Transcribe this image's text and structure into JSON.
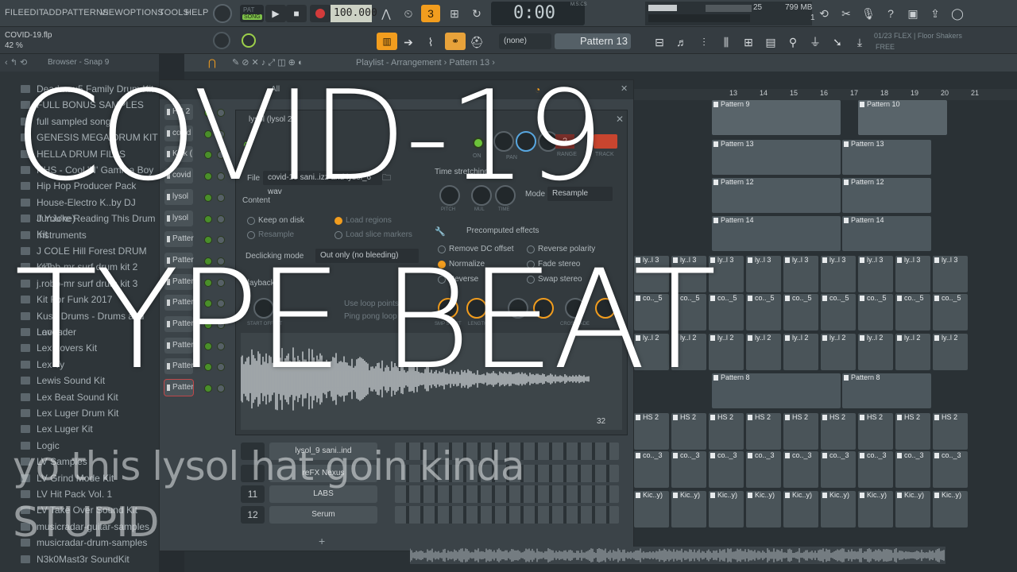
{
  "menu": [
    "FILE",
    "EDIT",
    "ADD",
    "PATTERNS",
    "VIEW",
    "OPTIONS",
    "TOOLS",
    "HELP"
  ],
  "transport": {
    "pat_label": "PAT",
    "song_label": "SONG",
    "tempo": "100.000",
    "time": "0:00",
    "time_sub": "00",
    "time_unit": "M:S:CS"
  },
  "system": {
    "cpu": "25",
    "memory": "799 MB",
    "polyphony": "1"
  },
  "project": {
    "name": "COVID-19.flp",
    "zoom": "42 %"
  },
  "pattern_bar": {
    "none_label": "(none)",
    "pattern_label": "Pattern 13"
  },
  "news": {
    "line1": "01/23  FLEX | Floor Shakers",
    "line2": "FREE"
  },
  "browser": {
    "title": "Browser - Snap 9",
    "items": [
      "Deadmau5 Family Drum Kit",
      "FULL BONUS SAMPLES",
      "full sampled songs",
      "GENESIS MEGA DRUM KIT",
      "HELLA DRUM FILLS",
      "HHS - Cool 'N' Gamma Boy",
      "Hip Hop Producer Pack",
      "House-Electro K..by DJ JunJoke)",
      "If You're Reading This Drum Kit",
      "Instruments",
      "J COLE Hill Forest DRUM KIT",
      "j.robb-mr surf drum kit 2",
      "j.robb-mr surf drum kit 3",
      "Kit For Funk 2017",
      "Kush Drums - Drums and Loops",
      "Lavender",
      "Lex Lovers Kit",
      "Lex Ty",
      "Lewis Sound Kit",
      "Lex Beat Sound Kit",
      "Lex Luger Drum Kit",
      "Lex Luger Kit",
      "Logic",
      "LV Samples",
      "LV Grind Mode Kit",
      "LV Hit Pack Vol. 1",
      "LV Take Over Sound Kit",
      "musicradar-guitar-samples",
      "musicradar-drum-samples",
      "N3k0Mast3r SoundKit"
    ]
  },
  "playlist": {
    "title": "Playlist - Arrangement › Pattern 13 ›",
    "ruler": [
      "13",
      "14",
      "15",
      "16",
      "17",
      "18",
      "19",
      "20",
      "21"
    ],
    "clips": [
      {
        "label": "Pattern 9"
      },
      {
        "label": "Pattern 10"
      },
      {
        "label": "Pattern 13"
      },
      {
        "label": "Pattern 13"
      },
      {
        "label": "Pattern 12"
      },
      {
        "label": "Pattern 12"
      },
      {
        "label": "Pattern 14"
      },
      {
        "label": "Pattern 14"
      },
      {
        "label": "Pattern 8"
      },
      {
        "label": "Pattern 8"
      }
    ],
    "lane_labels": [
      "ly..l 3",
      "co.._5",
      "ly..l 2",
      "HS 2",
      "co.._3",
      "Kic..y)"
    ]
  },
  "channel_rack": {
    "filter": "All",
    "channels": [
      "HS 2",
      "covid",
      "Kick (",
      "covid",
      "lysol",
      "lysol",
      "Patter",
      "Patter",
      "Patter",
      "Patter",
      "Patter",
      "Patter",
      "Patter",
      "Patter"
    ],
    "rows": [
      {
        "num": "",
        "name": "lysol_9 sani..ind"
      },
      {
        "num": "",
        "name": "reFX Nexus"
      },
      {
        "num": "11",
        "name": "LABS"
      },
      {
        "num": "12",
        "name": "Serum"
      }
    ]
  },
  "sampler": {
    "title": "lysol (lysol 2)",
    "file_label": "File",
    "file_value": "covid-19 sani..izz and lysol_6 wav",
    "content_label": "Content",
    "keep_on_disk": "Keep on disk",
    "resample": "Resample",
    "load_regions": "Load regions",
    "load_slice": "Load slice markers",
    "declicking_label": "Declicking mode",
    "declicking_value": "Out only (no bleeding)",
    "playback_label": "Playback",
    "use_loop": "Use loop points",
    "ping_pong": "Ping pong loop",
    "time_stretch": "Time stretching",
    "mode_label": "Mode",
    "mode_value": "Resample",
    "pitch": "PITCH",
    "mul": "MUL",
    "time": "TIME",
    "precomputed": "Precomputed effects",
    "remove_dc": "Remove DC offset",
    "normalize": "Normalize",
    "reverse": "Reverse",
    "reverse_polarity": "Reverse polarity",
    "fade_stereo": "Fade stereo",
    "swap_stereo": "Swap stereo",
    "smp_start": "SMP START",
    "length": "LENGTH",
    "crossfade": "CROSSFADE",
    "start_offset": "START OFFSET",
    "on_label": "ON",
    "pan_label": "PAN",
    "range_label": "RANGE",
    "track_label": "TRACK",
    "range_value": "2",
    "wave_footer": "32"
  },
  "overlay": {
    "line1": "COVID-19",
    "line2": "TYPE BEAT",
    "caption1": "yo this lysol hat goin kinda",
    "caption2": "STUPID"
  },
  "colors": {
    "accent": "#f29d1e",
    "green": "#7fc24a",
    "text_white": "#ffffff"
  }
}
